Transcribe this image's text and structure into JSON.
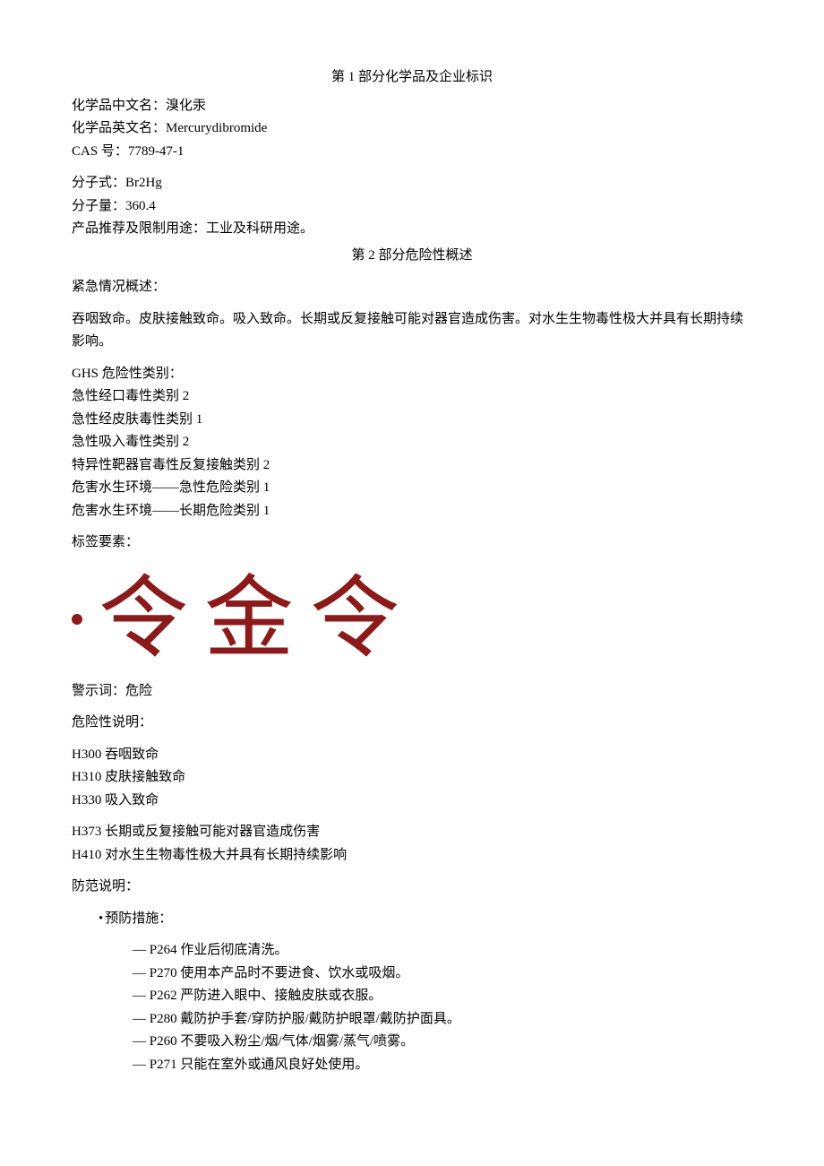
{
  "section1": {
    "title": "第 1 部分化学品及企业标识",
    "cn_name_label": "化学品中文名：",
    "cn_name_value": "溴化汞",
    "en_name_label": "化学品英文名：",
    "en_name_value": "Mercurydibromide",
    "cas_label": "CAS 号：",
    "cas_value": "7789-47-1",
    "formula_label": "分子式：",
    "formula_value": "Br2Hg",
    "mw_label": "分子量：",
    "mw_value": "360.4",
    "use_label": "产品推荐及限制用途：",
    "use_value": "工业及科研用途。"
  },
  "section2": {
    "title": "第 2 部分危险性概述",
    "emergency_label": "紧急情况概述：",
    "emergency_text": "吞咽致命。皮肤接触致命。吸入致命。长期或反复接触可能对器官造成伤害。对水生生物毒性极大并具有长期持续影响。",
    "ghs_label": "GHS 危险性类别：",
    "ghs_items": [
      "急性经口毒性类别 2",
      "急性经皮肤毒性类别 1",
      "急性吸入毒性类别 2",
      "特异性靶器官毒性反复接触类别 2",
      "危害水生环境——急性危险类别 1",
      "危害水生环境——长期危险类别 1"
    ],
    "label_elements_label": "标签要素：",
    "pictograms": [
      "令",
      "金",
      "令"
    ],
    "signal_label": "警示词：",
    "signal_value": "危险",
    "hazard_statements_label": "危险性说明：",
    "hazard_statements": [
      "H300 吞咽致命",
      "H310 皮肤接触致命",
      "H330 吸入致命",
      "H373 长期或反复接触可能对器官造成伤害",
      "H410 对水生生物毒性极大并具有长期持续影响"
    ],
    "precaution_label": "防范说明：",
    "prevention_label": "预防措施：",
    "prevention_items": [
      "P264 作业后彻底清洗。",
      "P270 使用本产品时不要进食、饮水或吸烟。",
      "P262 严防进入眼中、接触皮肤或衣服。",
      "P280 戴防护手套/穿防护服/戴防护眼罩/戴防护面具。",
      "P260 不要吸入粉尘/烟/气体/烟雾/蒸气/喷雾。",
      "P271 只能在室外或通风良好处使用。"
    ]
  }
}
